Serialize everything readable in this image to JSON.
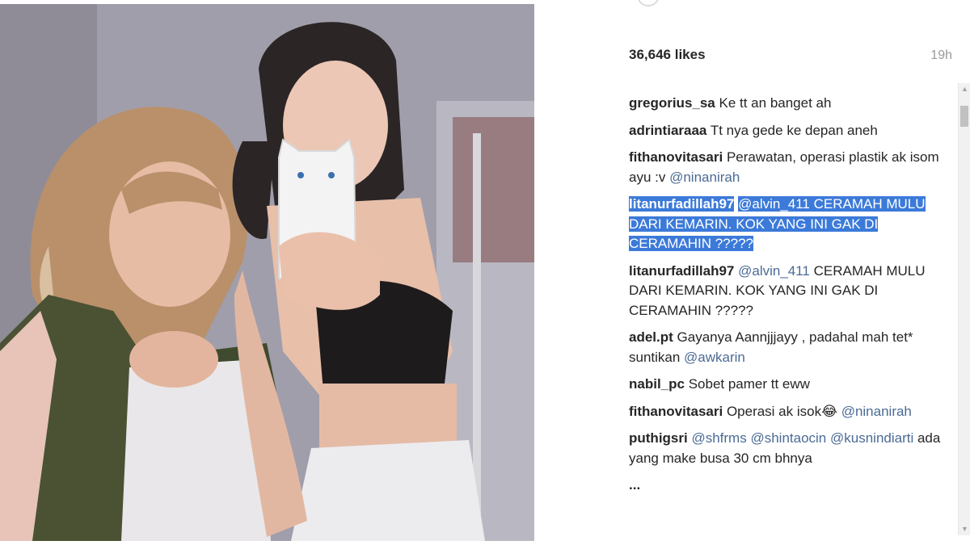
{
  "post": {
    "likes": "36,646 likes",
    "time": "19h"
  },
  "comments": [
    {
      "user": "gregorius_sa",
      "text": "Ke tt an banget ah"
    },
    {
      "user": "adrintiaraaa",
      "text": "Tt nya gede ke depan aneh"
    },
    {
      "user": "fithanovitasari",
      "text": "Perawatan, operasi plastik ak isom ayu :v ",
      "mention": "@ninanirah"
    },
    {
      "user": "litanurfadillah97",
      "mention": "@alvin_411",
      "text": " CERAMAH MULU DARI KEMARIN. KOK YANG INI GAK DI CERAMAHIN ?????",
      "selected": true
    },
    {
      "user": "litanurfadillah97",
      "mention": "@alvin_411",
      "text": " CERAMAH MULU DARI KEMARIN. KOK YANG INI GAK DI CERAMAHIN ?????"
    },
    {
      "user": "adel.pt",
      "text": "Gayanya Aannjjjayy , padahal mah tet* suntikan ",
      "mention": "@awkarin"
    },
    {
      "user": "nabil_pc",
      "text": "Sobet pamer tt eww"
    },
    {
      "user": "fithanovitasari",
      "text": "Operasi ak isok😂 ",
      "mention": "@ninanirah"
    },
    {
      "user": "puthigsri",
      "mentions": [
        "@shfrms",
        "@shintaocin",
        "@kusnindiarti"
      ],
      "text": " ada yang make busa 30 cm bhnya"
    },
    {
      "user": "...",
      "text": ""
    }
  ],
  "colors": {
    "mention": "#4b6b95",
    "selection": "#3c7ad9",
    "text": "#262626"
  }
}
